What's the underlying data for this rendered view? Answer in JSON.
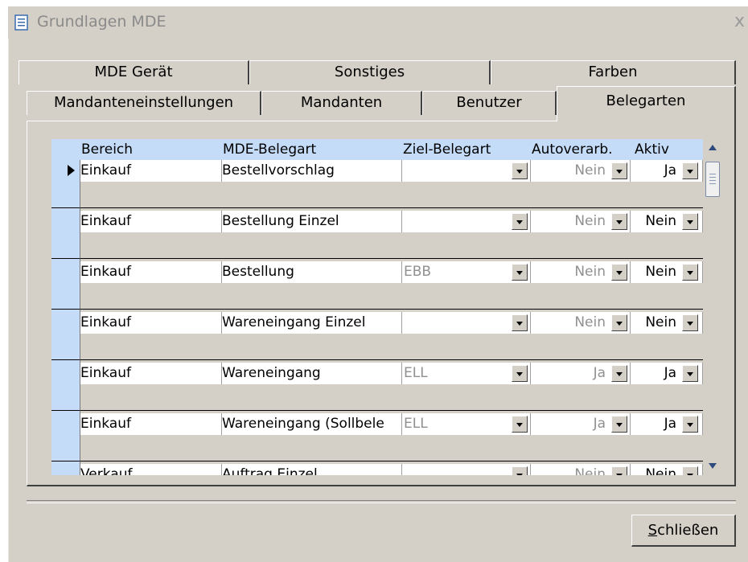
{
  "window": {
    "title": "Grundlagen MDE",
    "close_glyph": "x",
    "icon": "list-window-icon"
  },
  "tabs_row1": [
    {
      "label": "MDE Gerät"
    },
    {
      "label": "Sonstiges"
    },
    {
      "label": "Farben"
    }
  ],
  "tabs_row2": [
    {
      "label": "Mandanteneinstellungen"
    },
    {
      "label": "Mandanten"
    },
    {
      "label": "Benutzer"
    },
    {
      "label": "Belegarten",
      "selected": true
    }
  ],
  "grid": {
    "headers": [
      "Bereich",
      "MDE-Belegart",
      "Ziel-Belegart",
      "Autoverarb.",
      "Aktiv"
    ],
    "rows": [
      {
        "bereich": "Einkauf",
        "mde_belegart": "Bestellvorschlag",
        "ziel_belegart": "",
        "autoverarb": "Nein",
        "aktiv": "Ja"
      },
      {
        "bereich": "Einkauf",
        "mde_belegart": "Bestellung Einzel",
        "ziel_belegart": "",
        "autoverarb": "Nein",
        "aktiv": "Nein"
      },
      {
        "bereich": "Einkauf",
        "mde_belegart": "Bestellung",
        "ziel_belegart": "EBB",
        "autoverarb": "Nein",
        "aktiv": "Nein"
      },
      {
        "bereich": "Einkauf",
        "mde_belegart": "Wareneingang Einzel",
        "ziel_belegart": "",
        "autoverarb": "Nein",
        "aktiv": "Nein"
      },
      {
        "bereich": "Einkauf",
        "mde_belegart": "Wareneingang",
        "ziel_belegart": "ELL",
        "autoverarb": "Ja",
        "aktiv": "Ja"
      },
      {
        "bereich": "Einkauf",
        "mde_belegart": "Wareneingang (Sollbele",
        "ziel_belegart": "ELL",
        "autoverarb": "Ja",
        "aktiv": "Ja"
      },
      {
        "bereich": "Verkauf",
        "mde_belegart": "Auftrag Einzel",
        "ziel_belegart": "",
        "autoverarb": "Nein",
        "aktiv": "Nein"
      }
    ]
  },
  "buttons": {
    "close_mnemonic": "S",
    "close_rest": "chließen"
  },
  "colors": {
    "window_bg": "#d4d0c8",
    "header_bg": "#c4dcf8",
    "muted_text": "#909090"
  }
}
